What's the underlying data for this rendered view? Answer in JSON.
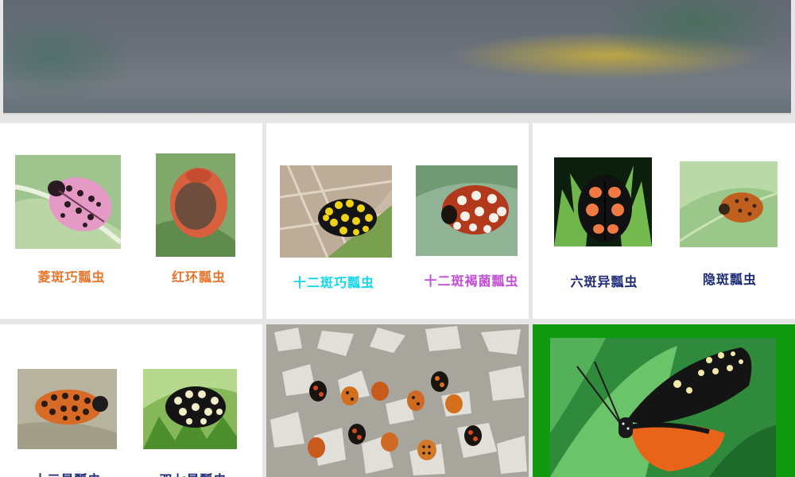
{
  "captions": {
    "c1": "菱斑巧瓢虫",
    "c2": "红环瓢虫",
    "c3": "十二斑巧瓢虫",
    "c4": "十二斑褐菌瓢虫",
    "c5": "六斑异瓢虫",
    "c6": "隐斑瓢虫",
    "c7": "十三星瓢虫",
    "c8": "双七星瓢虫"
  },
  "colors": {
    "caption_orange": "#e8742a",
    "caption_cyan": "#12d6ea",
    "caption_violet": "#c34dd8",
    "caption_navy": "#1d2a78",
    "butterfly_frame": "#0f9a10"
  }
}
